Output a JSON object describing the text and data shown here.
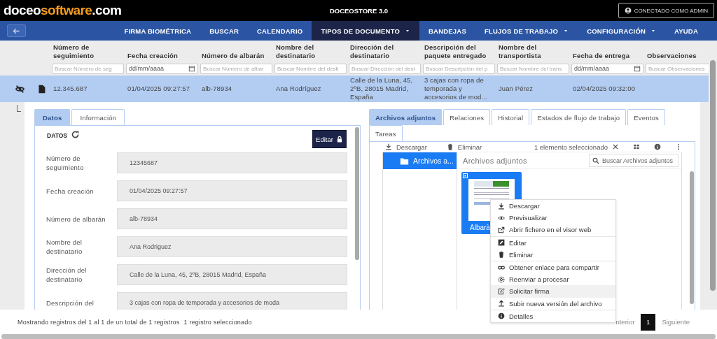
{
  "header": {
    "logo": {
      "primary": "doceo",
      "accent": "software",
      "suffix": ".com"
    },
    "title": "DOCEOSTORE 3.0",
    "user_button": "CONECTADO COMO ADMIN"
  },
  "nav": {
    "items": [
      {
        "label": "FIRMA BIOMÉTRICA",
        "selected": false,
        "dropdown": false
      },
      {
        "label": "BUSCAR",
        "selected": false,
        "dropdown": false
      },
      {
        "label": "CALENDARIO",
        "selected": false,
        "dropdown": false
      },
      {
        "label": "TIPOS DE DOCUMENTO",
        "selected": true,
        "dropdown": true
      },
      {
        "label": "BANDEJAS",
        "selected": false,
        "dropdown": false
      },
      {
        "label": "FLUJOS DE TRABAJO",
        "selected": false,
        "dropdown": true
      },
      {
        "label": "CONFIGURACIÓN",
        "selected": false,
        "dropdown": true
      },
      {
        "label": "AYUDA",
        "selected": false,
        "dropdown": false
      }
    ]
  },
  "table": {
    "columns": [
      {
        "label": "Número de seguimiento",
        "filter": {
          "kind": "text",
          "placeholder": "Buscar Número de seg"
        }
      },
      {
        "label": "Fecha creación",
        "filter": {
          "kind": "date",
          "placeholder": "dd/mm/aaaa"
        }
      },
      {
        "label": "Número de albarán",
        "filter": {
          "kind": "text",
          "placeholder": "Buscar Número de albar"
        }
      },
      {
        "label": "Nombre del destinatario",
        "filter": {
          "kind": "text",
          "placeholder": "Buscar Nombre del desti"
        }
      },
      {
        "label": "Dirección del destinatario",
        "filter": {
          "kind": "text",
          "placeholder": "Buscar Dirección del dest"
        }
      },
      {
        "label": "Descripción del paquete entregado",
        "filter": {
          "kind": "text",
          "placeholder": "Buscar Descripción del p"
        }
      },
      {
        "label": "Nombre del transportista",
        "filter": {
          "kind": "text",
          "placeholder": "Buscar Nombre del trans"
        }
      },
      {
        "label": "Fecha de entrega",
        "filter": {
          "kind": "date",
          "placeholder": "dd/mm/aaaa"
        }
      },
      {
        "label": "Observaciones",
        "filter": {
          "kind": "text",
          "placeholder": "Buscar Observaciones"
        }
      }
    ],
    "rows": [
      {
        "selected": true,
        "cells": [
          "12.345.687",
          "01/04/2025 09:27:57",
          "alb-78934",
          "Ana Rodríguez",
          "Calle de la Luna, 45, 2ºB, 28015 Madrid, España",
          "3 cajas con ropa de temporada y accesorios de mod...",
          "Juan Pérez",
          "02/04/2025 09:32:00"
        ]
      }
    ]
  },
  "detail": {
    "left": {
      "tabs": [
        {
          "label": "Datos",
          "selected": true
        },
        {
          "label": "Información",
          "selected": false
        }
      ],
      "section_title": "DATOS",
      "edit_button": "Editar",
      "fields": [
        {
          "label": "Número de seguimiento",
          "value": "12345687"
        },
        {
          "label": "Fecha creación",
          "value": "01/04/2025 09:27:57"
        },
        {
          "label": "Número de albarán",
          "value": "alb-78934"
        },
        {
          "label": "Nombre del destinatario",
          "value": "Ana Rodriguez"
        },
        {
          "label": "Dirección del destinatario",
          "value": "Calle de la Luna, 45, 2ºB, 28015 Madrid, España"
        },
        {
          "label": "Descripción del",
          "value": "3 cajas con ropa de temporada y accesorios de moda"
        }
      ]
    },
    "right": {
      "tabs": [
        {
          "label": "Archivos adjuntos",
          "selected": true
        },
        {
          "label": "Relaciones",
          "selected": false
        },
        {
          "label": "Historial",
          "selected": false
        },
        {
          "label": "Estados de flujo de trabajo",
          "selected": false
        },
        {
          "label": "Eventos",
          "selected": false
        },
        {
          "label": "Tareas",
          "selected": false
        }
      ],
      "toolbar": {
        "download": "Descargar",
        "delete": "Eliminar",
        "selection": "1 elemento seleccionado"
      },
      "folders": [
        {
          "label": "Archivos a...",
          "selected": true
        }
      ],
      "breadcrumb": "Archivos adjuntos",
      "search_placeholder": "Buscar Archivos adjuntos",
      "files": [
        {
          "name": "Albarà",
          "selected": true,
          "checked": true
        }
      ],
      "context_menu": [
        [
          {
            "label": "Descargar",
            "highlighted": false
          },
          {
            "label": "Previsualizar",
            "highlighted": false
          },
          {
            "label": "Abrir fichero en el visor web",
            "highlighted": false
          }
        ],
        [
          {
            "label": "Editar",
            "highlighted": false
          },
          {
            "label": "Eliminar",
            "highlighted": false
          }
        ],
        [
          {
            "label": "Obtener enlace para compartir",
            "highlighted": false
          },
          {
            "label": "Reenviar a procesar",
            "highlighted": false
          },
          {
            "label": "Solicitar firma",
            "highlighted": true
          },
          {
            "label": "Subir nueva versión del archivo",
            "highlighted": false
          }
        ],
        [
          {
            "label": "Detalles",
            "highlighted": false
          }
        ]
      ]
    }
  },
  "footer": {
    "summary": "Mostrando registros del 1 al 1 de un total de 1 registros",
    "selection": "1 registro seleccionado",
    "pagination": {
      "previous": "nterior",
      "pages": [
        {
          "label": "1",
          "selected": true
        }
      ],
      "next": "Siguiente"
    }
  }
}
